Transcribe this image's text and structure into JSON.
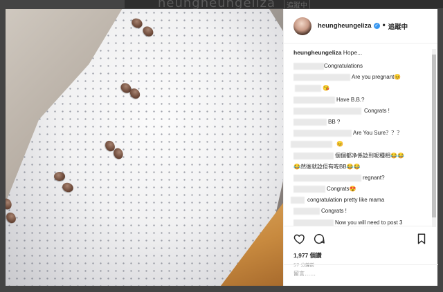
{
  "background": {
    "title": "heungheungeliza",
    "follow_label": "追蹤中"
  },
  "post": {
    "username": "heungheungeliza",
    "verified": true,
    "separator": "•",
    "follow_status": "追蹤中",
    "caption_user": "heungheungeliza",
    "caption_text": "Hope...",
    "comments": [
      {
        "text": "Congratulations"
      },
      {
        "text": "Are you pregnant😊"
      },
      {
        "text": "😘"
      },
      {
        "text": "Have B.B.?"
      },
      {
        "text": "Congrats !"
      },
      {
        "text": "BB ?"
      },
      {
        "text": "Are You Sure？？？"
      },
      {
        "text": "😊"
      },
      {
        "text": "個個都净係諗到呢種相😂😂"
      },
      {
        "text": "😂然後就諗佢有咗BB😂😂"
      },
      {
        "text": "regnant?"
      },
      {
        "text": "Congrats😍"
      },
      {
        "text": "congratulation pretty like mama"
      },
      {
        "text": "Congrats !"
      },
      {
        "text": "Now you will need to post 3"
      }
    ],
    "likes": "1,977 個讚",
    "time": "57 分鐘前",
    "comment_placeholder": "留言……"
  },
  "icons": {
    "like": "heart-icon",
    "comment": "comment-icon",
    "save": "bookmark-icon",
    "verified": "verified-badge-icon"
  },
  "colors": {
    "verified_blue": "#3897f0",
    "text": "#262626",
    "muted": "#999999"
  }
}
